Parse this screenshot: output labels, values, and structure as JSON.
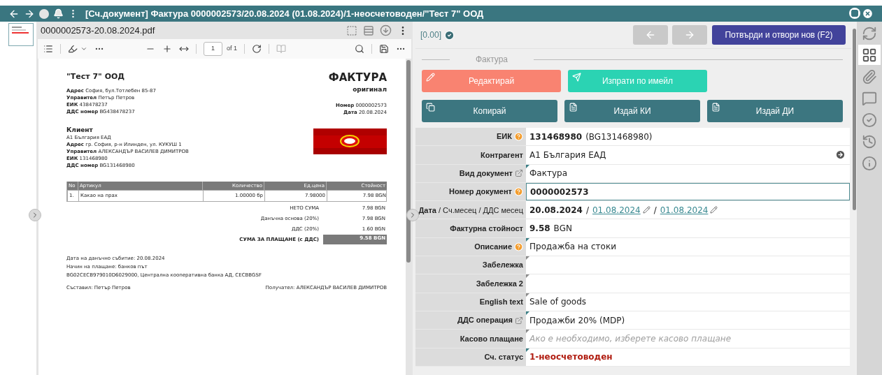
{
  "title_bar": {
    "title": "[Сч.документ] Фактура 0000002573/20.08.2024 (01.08.2024)/1-неосчетоводен/\"Тест 7\" ООД"
  },
  "pdf": {
    "file_name": "0000002573-20.08.2024.pdf",
    "page_input": "1",
    "page_total": "of 1",
    "document": {
      "seller": {
        "name": "\"Тест 7\" ООД",
        "lines": [
          {
            "label": "Адрес",
            "value": "София, бул.Тотлебен 85-87"
          },
          {
            "label": "Управител",
            "value": "Петър Петров"
          },
          {
            "label": "ЕИК",
            "value": "438478237"
          },
          {
            "label": "ДДС номер",
            "value": "BG438478237"
          }
        ]
      },
      "title": "ФАКТУРА",
      "subtitle": "оригинал",
      "meta": [
        {
          "label": "Номер",
          "value": "0000002573"
        },
        {
          "label": "Дата",
          "value": "20.08.2024"
        }
      ],
      "client": {
        "heading": "Клиент",
        "name": "А1 България ЕАД",
        "lines": [
          {
            "label": "Адрес",
            "value": "гр. София, р-н Илинден, ул. КУКУШ 1"
          },
          {
            "label": "Управител",
            "value": "АЛЕКСАНДЪР ВАСИЛЕВ ДИМИТРОВ"
          },
          {
            "label": "ЕИК",
            "value": "131468980"
          },
          {
            "label": "ДДС номер",
            "value": "BG131468980"
          }
        ]
      },
      "table": {
        "columns": [
          "No",
          "Артикул",
          "Количество",
          "Ед.цена",
          "Стойност"
        ],
        "rows": [
          [
            "1.",
            "Какао на прах",
            "1.00000 бр",
            "7.98000",
            "7.98 BGN"
          ]
        ]
      },
      "totals": [
        {
          "kind": "normal",
          "label": "НЕТО СУМА",
          "value": "7.98 BGN"
        },
        {
          "kind": "normal",
          "label": "Данъчна основа (20%)",
          "value": "7.98 BGN"
        },
        {
          "kind": "normal",
          "label": "ДДС (20%)",
          "value": "1.60 BGN"
        },
        {
          "kind": "grand",
          "label": "СУМА ЗА ПЛАЩАНЕ (с ДДС)",
          "value": "9.58 BGN"
        }
      ],
      "notes": [
        "Дата на данъчно събитие: 20.08.2024",
        "Начин на плащане: банков път",
        "BG02CECB979010D6029000, Централна кооперативна банка АД, CECBBGSF"
      ],
      "signatures": [
        "Съставил: Петър Петров",
        "Получател: АЛЕКСАНДЪР ВАСИЛЕВ ДИМИТРОВ"
      ]
    }
  },
  "form": {
    "balance": "[0.00]",
    "nav": [
      {
        "kind": "prev",
        "disabled": true
      },
      {
        "kind": "next",
        "disabled": true
      }
    ],
    "primary_button": "Потвърди и отвори нов (F2)",
    "section": "Фактура",
    "actions": [
      [
        {
          "kind": "edit",
          "label": "Редактирай",
          "color": "#f98371"
        },
        {
          "kind": "send",
          "label": "Изпрати по имейл",
          "color": "#2bd3b3"
        }
      ],
      [
        {
          "kind": "copy",
          "label": "Копирай",
          "color": "#3c7680"
        },
        {
          "kind": "issue",
          "label": "Издай КИ",
          "color": "#3c7680"
        },
        {
          "kind": "issue",
          "label": "Издай ДИ",
          "color": "#3c7680"
        }
      ]
    ],
    "rows": [
      {
        "kind": "plain",
        "label": "ЕИК",
        "help": true,
        "parts": [
          {
            "kind": "bold",
            "text": "131468980"
          },
          {
            "kind": "text",
            "text": "(BG131468980)"
          }
        ]
      },
      {
        "kind": "plain",
        "label": "Контрагент",
        "arrow": true,
        "parts": [
          {
            "kind": "text",
            "text": "А1 България ЕАД"
          }
        ]
      },
      {
        "kind": "plain",
        "label": "Вид документ",
        "external_link": true,
        "marker": {
          "color": "#3c7f86"
        },
        "parts": [
          {
            "kind": "text",
            "text": "Фактура"
          }
        ]
      },
      {
        "kind": "plain",
        "label": "Номер документ",
        "help": true,
        "input": true,
        "parts": [
          {
            "kind": "bold",
            "text": "0000002573"
          }
        ]
      },
      {
        "kind": "dates",
        "label": "**Дата** / Сч.месец / ДДС месец",
        "parts": [
          {
            "kind": "bold",
            "text": "20.08.2024"
          },
          {
            "kind": "text",
            "text": "/"
          },
          {
            "kind": "link",
            "text": "01.08.2024"
          },
          {
            "kind": "text",
            "text": "/"
          },
          {
            "kind": "link",
            "text": "01.08.2024"
          }
        ]
      },
      {
        "kind": "plain",
        "label": "Фактурна стойност",
        "parts": [
          {
            "kind": "bold",
            "text": "9.58"
          },
          {
            "kind": "text",
            "text": "BGN"
          }
        ]
      },
      {
        "kind": "plain",
        "label": "Описание",
        "help": true,
        "marker": {
          "color": "#3c7f86"
        },
        "parts": [
          {
            "kind": "text",
            "text": "Продажба на стоки"
          }
        ]
      },
      {
        "kind": "plain",
        "label": "Забележка",
        "marker": {
          "color": "#8c8c8c"
        },
        "parts": []
      },
      {
        "kind": "plain",
        "label": "Забележка 2",
        "marker": {
          "color": "#8c8c8c"
        },
        "parts": []
      },
      {
        "kind": "plain",
        "label": "English text",
        "marker": {
          "color": "#8c8c8c"
        },
        "parts": [
          {
            "kind": "text",
            "text": "Sale of goods"
          }
        ]
      },
      {
        "kind": "plain",
        "label": "ДДС операция",
        "external_link": true,
        "marker": {
          "color": "#3c7f86"
        },
        "parts": [
          {
            "kind": "text",
            "text": "Продажби 20% (MDP)"
          }
        ]
      },
      {
        "kind": "plain",
        "label": "Касово плащане",
        "marker": {
          "color": "#8c8c8c"
        },
        "parts": [
          {
            "kind": "placeholder",
            "text": "Ако е необходимо, изберете касово плащане"
          }
        ]
      },
      {
        "kind": "plain",
        "label": "Сч. статус",
        "marker": {
          "color": "#3c7f86"
        },
        "parts": [
          {
            "kind": "status",
            "text": "1-неосчетоводен"
          }
        ]
      }
    ]
  },
  "side_tools": [
    {
      "kind": "refresh",
      "selected": false
    },
    {
      "kind": "grid",
      "selected": true
    },
    {
      "kind": "attachment",
      "selected": false
    },
    {
      "kind": "comment",
      "selected": false
    },
    {
      "kind": "check",
      "selected": false
    },
    {
      "kind": "history",
      "selected": false
    },
    {
      "kind": "info",
      "selected": false
    }
  ]
}
